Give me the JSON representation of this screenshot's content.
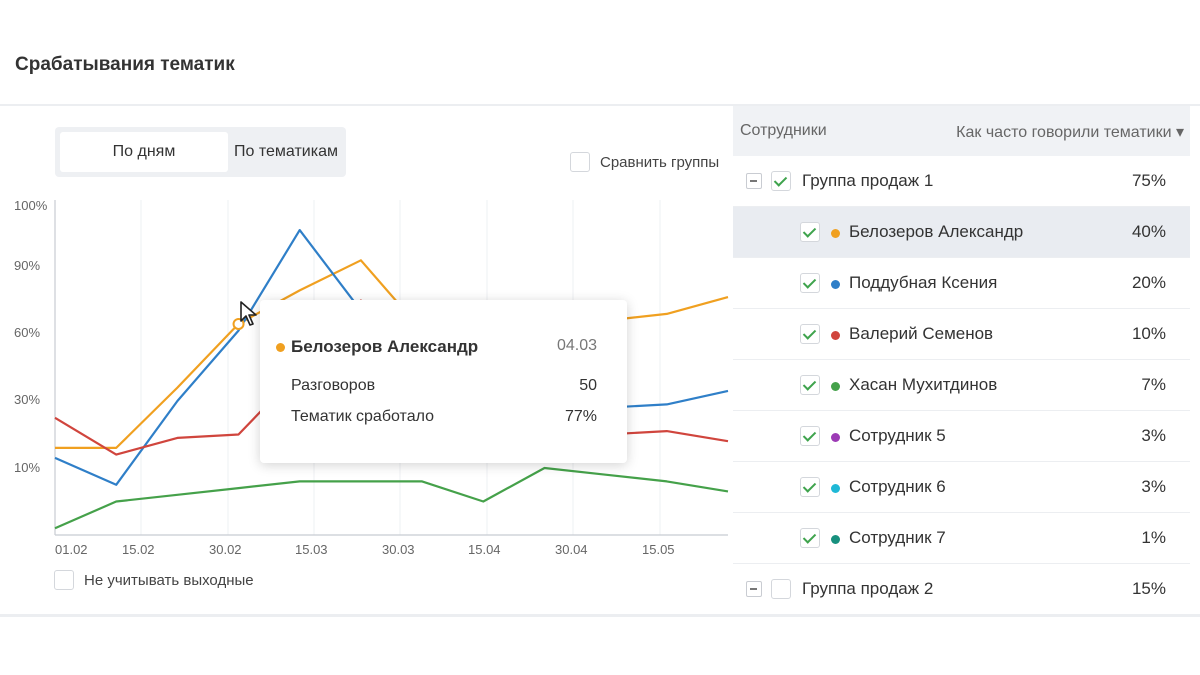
{
  "header": {
    "title": "Срабатывания тематик"
  },
  "toggle": {
    "by_days": "По дням",
    "by_topics": "По тематикам"
  },
  "compare_groups": {
    "label": "Сравнить группы",
    "checked": false
  },
  "exclude_weekends": {
    "label": "Не учитывать выходные",
    "checked": false
  },
  "tooltip": {
    "name": "Белозеров Александр",
    "date": "04.03",
    "color": "#f0a020",
    "rows": [
      {
        "label": "Разговоров",
        "value": "50"
      },
      {
        "label": "Тематик сработало",
        "value": "77%"
      }
    ]
  },
  "chart_data": {
    "type": "line",
    "y_ticks": [
      "100%",
      "90%",
      "60%",
      "30%",
      "10%"
    ],
    "x_ticks": [
      "01.02",
      "15.02",
      "30.02",
      "15.03",
      "30.03",
      "15.04",
      "30.04",
      "15.05"
    ],
    "series": [
      {
        "color": "#f0a020",
        "values": [
          26,
          26,
          44,
          63,
          73,
          82,
          61,
          55,
          52,
          64,
          66,
          71
        ]
      },
      {
        "color": "#2f7fc8",
        "values": [
          23,
          15,
          40,
          61,
          91,
          67,
          50,
          40,
          39,
          38,
          39,
          43
        ]
      },
      {
        "color": "#d0453d",
        "values": [
          35,
          24,
          29,
          30,
          49,
          70,
          44,
          34,
          28,
          30,
          31,
          28
        ]
      },
      {
        "color": "#45a14a",
        "values": [
          2,
          10,
          12,
          14,
          16,
          16,
          16,
          10,
          20,
          18,
          16,
          13
        ]
      }
    ]
  },
  "panel": {
    "col_employees": "Сотрудники",
    "col_frequency": "Как часто говорили тематики ▾",
    "rows": [
      {
        "kind": "group",
        "name": "Группа продаж 1",
        "pct": "75%",
        "checked": true
      },
      {
        "kind": "person",
        "name": "Белозеров Александр",
        "pct": "40%",
        "color": "#f0a020",
        "checked": true,
        "highlight": true
      },
      {
        "kind": "person",
        "name": "Поддубная Ксения",
        "pct": "20%",
        "color": "#2f7fc8",
        "checked": true
      },
      {
        "kind": "person",
        "name": "Валерий Семенов",
        "pct": "10%",
        "color": "#d0453d",
        "checked": true
      },
      {
        "kind": "person",
        "name": "Хасан Мухитдинов",
        "pct": "7%",
        "color": "#45a14a",
        "checked": true
      },
      {
        "kind": "person",
        "name": "Сотрудник 5",
        "pct": "3%",
        "color": "#9c3bb5",
        "checked": true
      },
      {
        "kind": "person",
        "name": "Сотрудник 6",
        "pct": "3%",
        "color": "#1fb8d6",
        "checked": true
      },
      {
        "kind": "person",
        "name": "Сотрудник 7",
        "pct": "1%",
        "color": "#18907e",
        "checked": true
      },
      {
        "kind": "group",
        "name": "Группа продаж 2",
        "pct": "15%",
        "checked": false
      }
    ]
  }
}
